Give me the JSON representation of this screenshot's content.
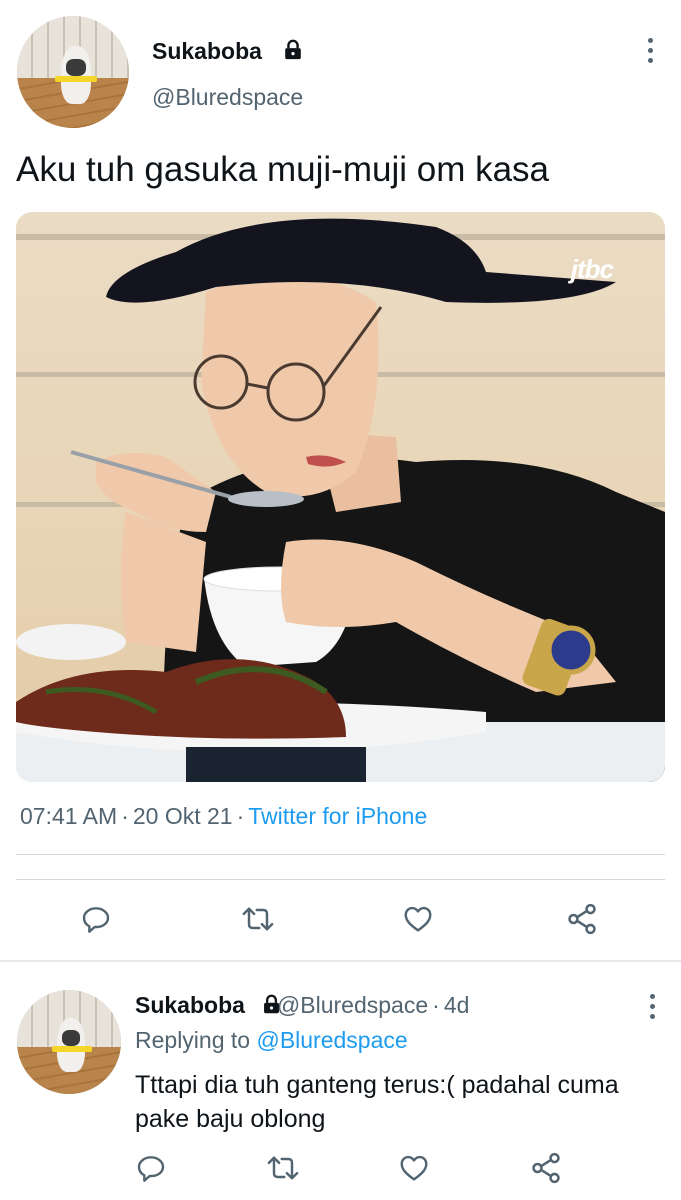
{
  "tweet": {
    "display_name": "Sukaboba",
    "handle": "@Bluredspace",
    "text": "Aku tuh gasuka muji-muji om kasa",
    "time": "07:41 AM",
    "date": "20 Okt 21",
    "source": "Twitter for iPhone",
    "separator": "·",
    "image_watermark": "jtbc"
  },
  "reply": {
    "display_name": "Sukaboba",
    "handle": "@Bluredspace",
    "age": "4d",
    "separator": "·",
    "replying_prefix": "Replying to",
    "replying_to": "@Bluredspace",
    "text": "Tttapi dia tuh ganteng terus:( padahal cuma pake baju oblong"
  },
  "icons": {
    "lock": "lock-icon",
    "more": "more-vertical-icon",
    "reply": "reply-icon",
    "retweet": "retweet-icon",
    "like": "heart-icon",
    "share": "share-icon"
  },
  "colors": {
    "accent": "#1d9bf0",
    "secondary_text": "#536471",
    "primary_text": "#0f1419"
  }
}
